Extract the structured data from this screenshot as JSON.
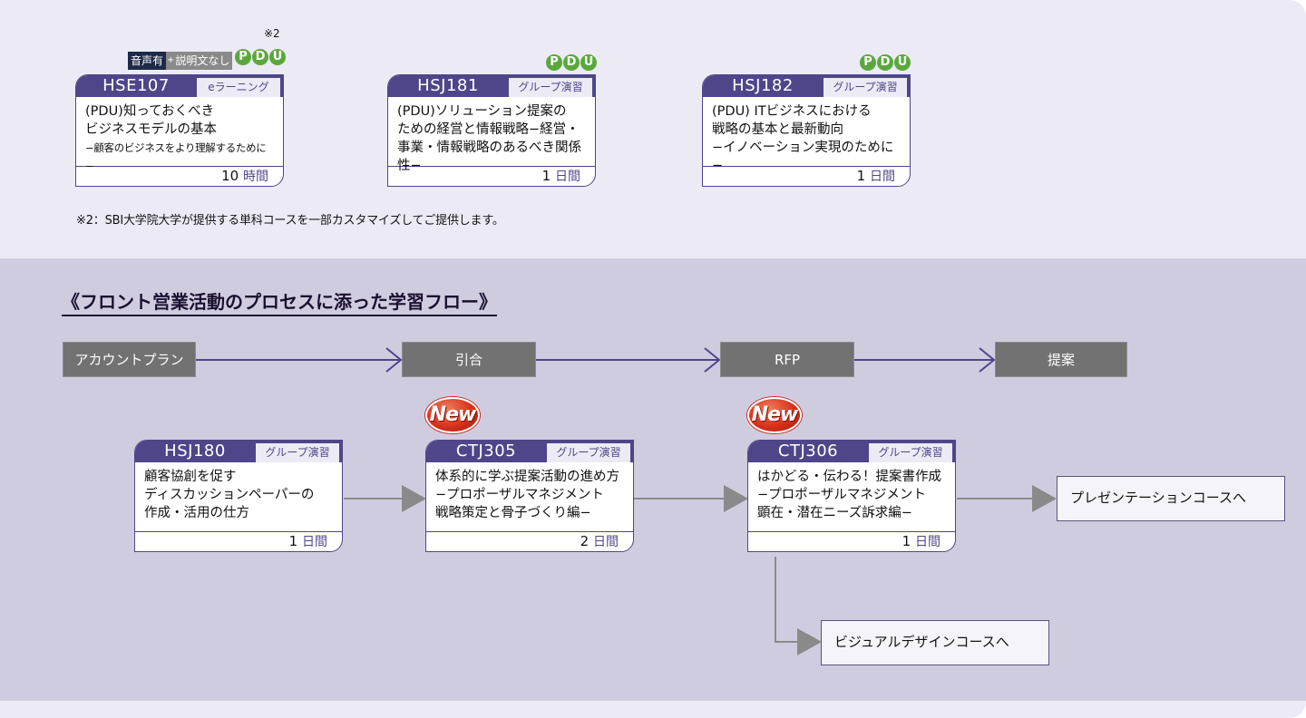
{
  "top_section": {
    "note_mark": "※2",
    "audio_tag": {
      "part1": "音声有",
      "plus": "+",
      "part2": "説明文なし"
    },
    "pdu_letters": [
      "P",
      "D",
      "U"
    ],
    "courses": [
      {
        "code": "HSE107",
        "type": "eラーニング",
        "lines": [
          "(PDU)知っておくべき",
          "ビジネスモデルの基本"
        ],
        "subline": "−顧客のビジネスをより理解するために−",
        "duration_num": "10",
        "duration_unit": "時間",
        "pdu": true
      },
      {
        "code": "HSJ181",
        "type": "グループ演習",
        "lines": [
          "(PDU)ソリューション提案の",
          "ための経営と情報戦略−経営・",
          "事業・情報戦略のあるべき関係性−"
        ],
        "duration_num": "1",
        "duration_unit": "日間",
        "pdu": true
      },
      {
        "code": "HSJ182",
        "type": "グループ演習",
        "lines": [
          "(PDU) ITビジネスにおける",
          "戦略の基本と最新動向",
          "−イノベーション実現のために−"
        ],
        "duration_num": "1",
        "duration_unit": "日間",
        "pdu": true
      }
    ],
    "footnote": "※2：SBI大学院大学が提供する単科コースを一部カスタマイズしてご提供します。"
  },
  "flow_section": {
    "title": "《フロント営業活動のプロセスに添った学習フロー》",
    "stages": [
      "アカウントプラン",
      "引合",
      "RFP",
      "提案"
    ],
    "new_label": "New",
    "courses": [
      {
        "code": "HSJ180",
        "type": "グループ演習",
        "lines": [
          "顧客協創を促す",
          "ディスカッションペーパーの",
          "作成・活用の仕方"
        ],
        "duration_num": "1",
        "duration_unit": "日間",
        "is_new": false
      },
      {
        "code": "CTJ305",
        "type": "グループ演習",
        "lines": [
          "体系的に学ぶ提案活動の進め方",
          "−プロポーザルマネジメント",
          "戦略策定と骨子づくり編−"
        ],
        "duration_num": "2",
        "duration_unit": "日間",
        "is_new": true
      },
      {
        "code": "CTJ306",
        "type": "グループ演習",
        "lines": [
          "はかどる・伝わる！提案書作成",
          "−プロポーザルマネジメント",
          "顕在・潜在ニーズ訴求編−"
        ],
        "duration_num": "1",
        "duration_unit": "日間",
        "is_new": true
      }
    ],
    "destinations": [
      "プレゼンテーションコースへ",
      "ビジュアルデザインコースへ"
    ]
  },
  "colors": {
    "card_border": "#4e4689",
    "pdu_green": "#5aa83c",
    "stage_gray": "#727272",
    "new_red": "#d6321c",
    "top_bg": "#ecebf5",
    "flow_bg": "#d0cce0"
  }
}
